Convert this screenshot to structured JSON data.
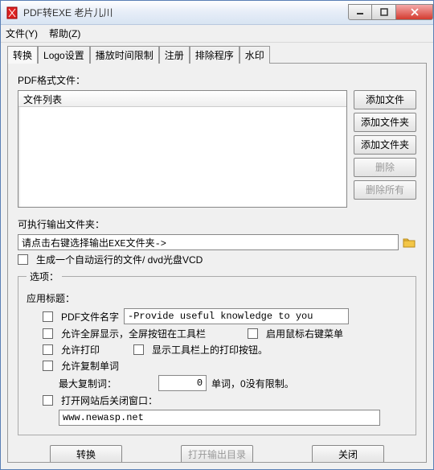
{
  "window": {
    "title": "PDF转EXE   老片儿川"
  },
  "menu": {
    "file": "文件(Y)",
    "help": "帮助(Z)"
  },
  "tabs": [
    "转换",
    "Logo设置",
    "播放时间限制",
    "注册",
    "排除程序",
    "水印"
  ],
  "pdf_section": {
    "label": "PDF格式文件：",
    "list_header": "文件列表",
    "btn_add_file": "添加文件",
    "btn_add_folder1": "添加文件夹",
    "btn_add_folder2": "添加文件夹",
    "btn_delete": "删除",
    "btn_delete_all": "删除所有"
  },
  "output": {
    "label": "可执行输出文件夹：",
    "path_value": "请点击右键选择输出EXE文件夹->",
    "autorun": "生成一个自动运行的文件/ dvd光盘VCD"
  },
  "options": {
    "legend": "选项：",
    "app_title_label": "应用标题：",
    "pdf_name_chk": "PDF文件名字",
    "pdf_name_value": "-Provide useful knowledge to you",
    "fullscreen": "允许全屏显示，全屏按钮在工具栏",
    "rightclick": "启用鼠标右键菜单",
    "allow_print": "允许打印",
    "show_print_btn": "显示工具栏上的打印按钮。",
    "allow_copy": "允许复制单词",
    "max_copy_label": "最大复制词：",
    "max_copy_value": "0",
    "max_copy_suffix": "单词，0没有限制。",
    "close_after_web": "打开网站后关闭窗口：",
    "url_value": "www.newasp.net"
  },
  "footer": {
    "convert": "转换",
    "open_output": "打开输出目录",
    "close": "关闭"
  }
}
